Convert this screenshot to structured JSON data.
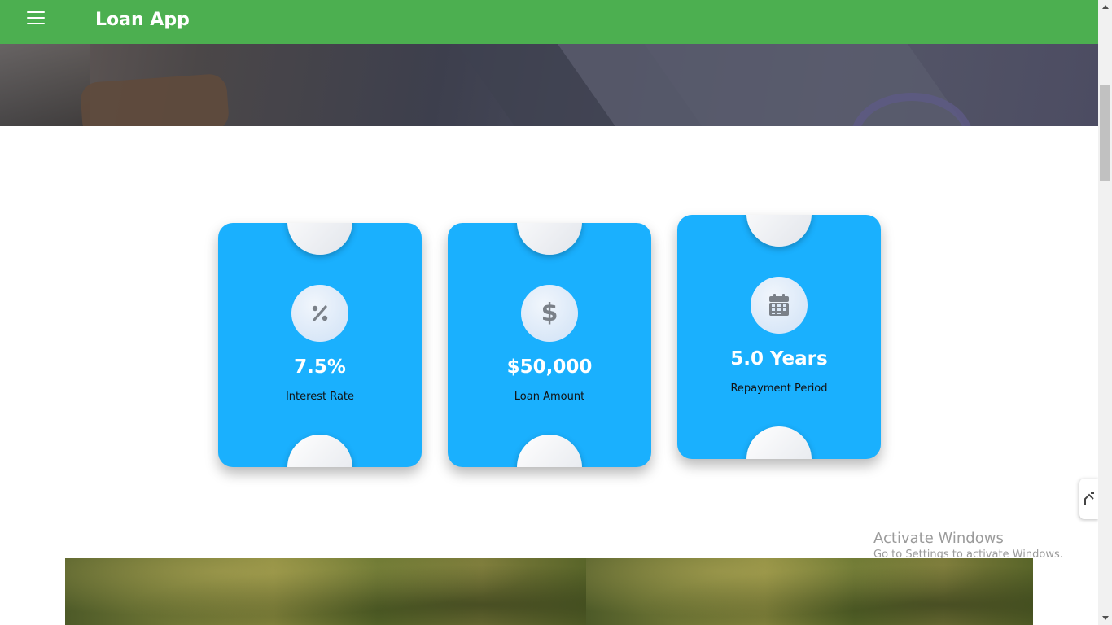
{
  "app": {
    "title": "Loan App"
  },
  "colors": {
    "topbar": "#4caf50",
    "card": "#1ab0fe",
    "icon": "#7a8088"
  },
  "cards": [
    {
      "icon": "percent-icon",
      "value": "7.5%",
      "label": "Interest Rate"
    },
    {
      "icon": "dollar-icon",
      "value": "$50,000",
      "label": "Loan Amount"
    },
    {
      "icon": "calendar-icon",
      "value": "5.0 Years",
      "label": "Repayment Period"
    }
  ],
  "watermark": {
    "title": "Activate Windows",
    "subtitle": "Go to Settings to activate Windows."
  }
}
